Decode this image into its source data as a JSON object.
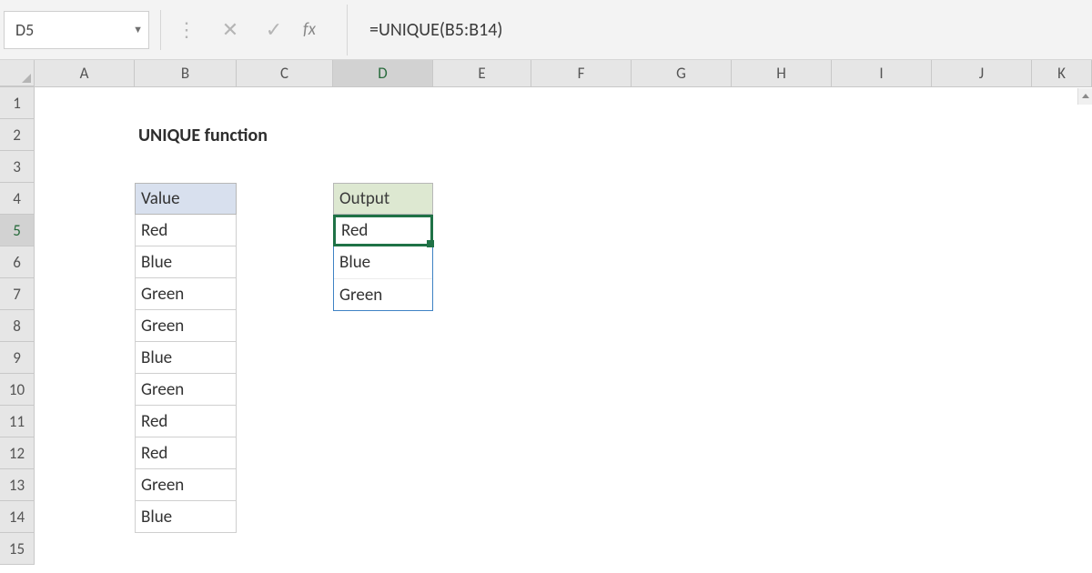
{
  "name_box": "D5",
  "fx_label": "fx",
  "formula": "=UNIQUE(B5:B14)",
  "columns": [
    "A",
    "B",
    "C",
    "D",
    "E",
    "F",
    "G",
    "H",
    "I",
    "J",
    "K"
  ],
  "active_col_index": 3,
  "rows": [
    "1",
    "2",
    "3",
    "4",
    "5",
    "6",
    "7",
    "8",
    "9",
    "10",
    "11",
    "12",
    "13",
    "14",
    "15"
  ],
  "active_row_index": 4,
  "title": "UNIQUE function",
  "value_header": "Value",
  "output_header": "Output",
  "values": [
    "Red",
    "Blue",
    "Green",
    "Green",
    "Blue",
    "Green",
    "Red",
    "Red",
    "Green",
    "Blue"
  ],
  "output": [
    "Red",
    "Blue",
    "Green"
  ]
}
